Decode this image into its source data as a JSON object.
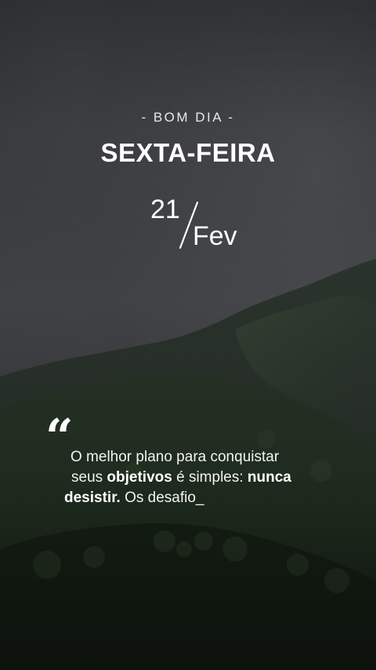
{
  "greeting": "- BOM DIA -",
  "weekday": "SEXTA-FEIRA",
  "date": {
    "day": "21",
    "month": "Fev"
  },
  "quote": {
    "mark": "“",
    "line1": "O melhor plano para conquistar",
    "line2_pre": "seus ",
    "line2_bold1": "objetivos",
    "line2_mid": " é simples: ",
    "line2_bold2": "nunca",
    "line3_bold": "desistir.",
    "line3_rest": " Os desafio_"
  },
  "colors": {
    "sky": "#35373b",
    "mountain": "#1f2a1f",
    "text": "#ffffff"
  }
}
